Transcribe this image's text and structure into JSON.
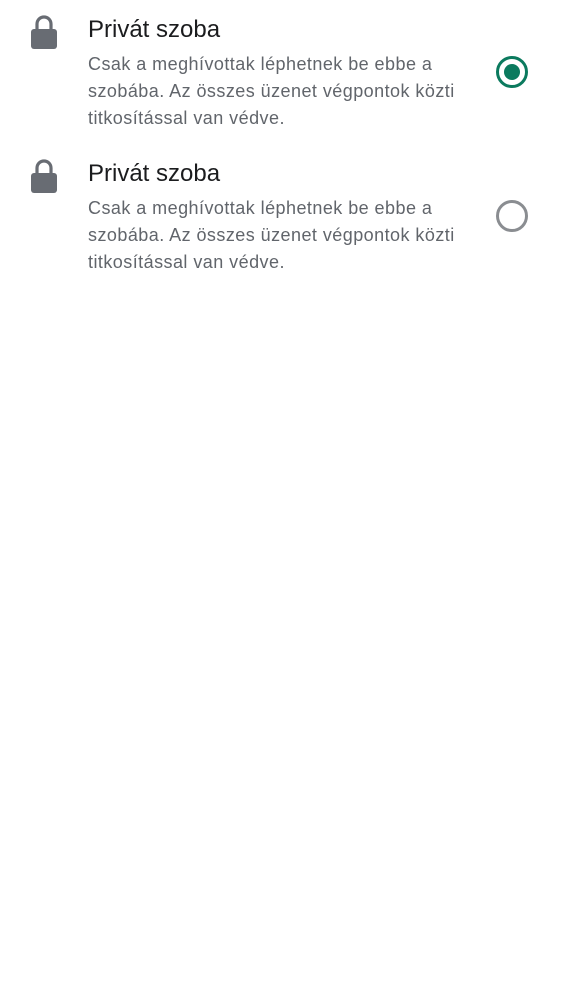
{
  "options": [
    {
      "title": "Privát szoba",
      "description": "Csak a meghívottak léphetnek be ebbe a szobába. Az összes üzenet végpontok közti titkosítással van védve.",
      "icon": "lock-icon",
      "selected": true
    },
    {
      "title": "Privát szoba",
      "description": "Csak a meghívottak léphetnek be ebbe a szobába. Az összes üzenet végpontok közti titkosítással van védve.",
      "icon": "lock-icon",
      "selected": false
    }
  ],
  "colors": {
    "accent": "#0b7a5e",
    "icon": "#686c73",
    "title_text": "#1b1c1e",
    "secondary_text": "#61656b",
    "radio_unselected": "#8a8d91"
  }
}
